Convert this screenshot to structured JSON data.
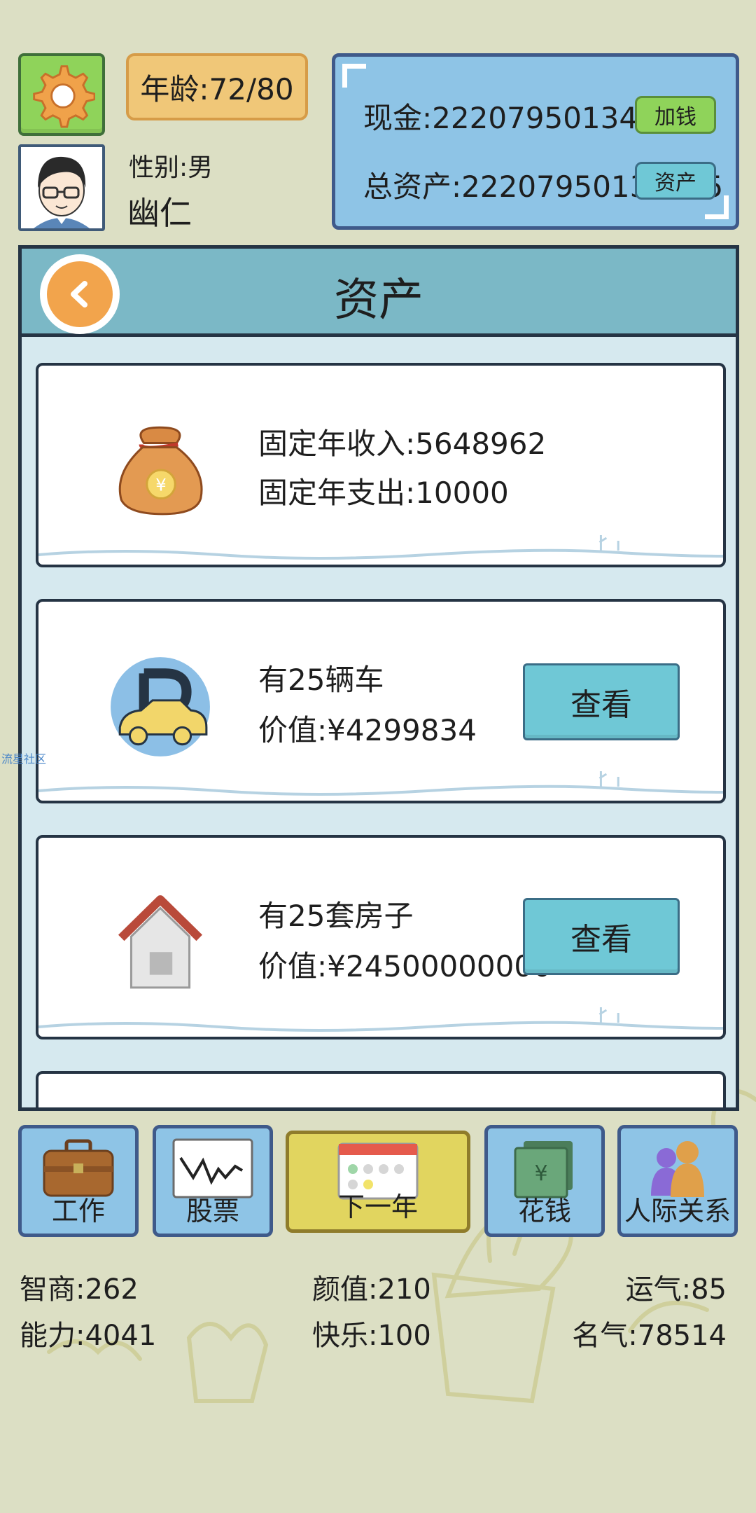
{
  "header": {
    "age_text": "年龄:72/80",
    "gender_text": "性别:男",
    "name": "幽仁",
    "cash_text": "现金:22207950134308",
    "total_assets_text": "总资产:22207950134845",
    "add_money_label": "加钱",
    "assets_label": "资产"
  },
  "panel": {
    "title": "资产",
    "income_card": {
      "line1": "固定年收入:5648962",
      "line2": "固定年支出:10000",
      "icon": "money-bag-icon"
    },
    "car_card": {
      "line1": "有25辆车",
      "line2": "价值:¥4299834",
      "button": "查看",
      "icon": "parking-car-icon"
    },
    "house_card": {
      "line1": "有25套房子",
      "line2": "价值:¥24500000000",
      "button": "查看",
      "icon": "house-icon"
    }
  },
  "nav": [
    {
      "label": "工作",
      "icon": "briefcase-icon"
    },
    {
      "label": "股票",
      "icon": "stock-chart-icon"
    },
    {
      "label": "下一年",
      "icon": "calendar-icon"
    },
    {
      "label": "花钱",
      "icon": "cash-stack-icon"
    },
    {
      "label": "人际关系",
      "icon": "people-icon"
    }
  ],
  "stats": {
    "iq": "智商:262",
    "looks": "颜值:210",
    "luck": "运气:85",
    "ability": "能力:4041",
    "happiness": "快乐:100",
    "fame": "名气:78514"
  },
  "watermark": "流星社区",
  "colors": {
    "background": "#dcdfc4",
    "panel_header": "#7bb8c6",
    "view_button": "#6fc8d6",
    "next_year_button": "#e1d55f"
  }
}
